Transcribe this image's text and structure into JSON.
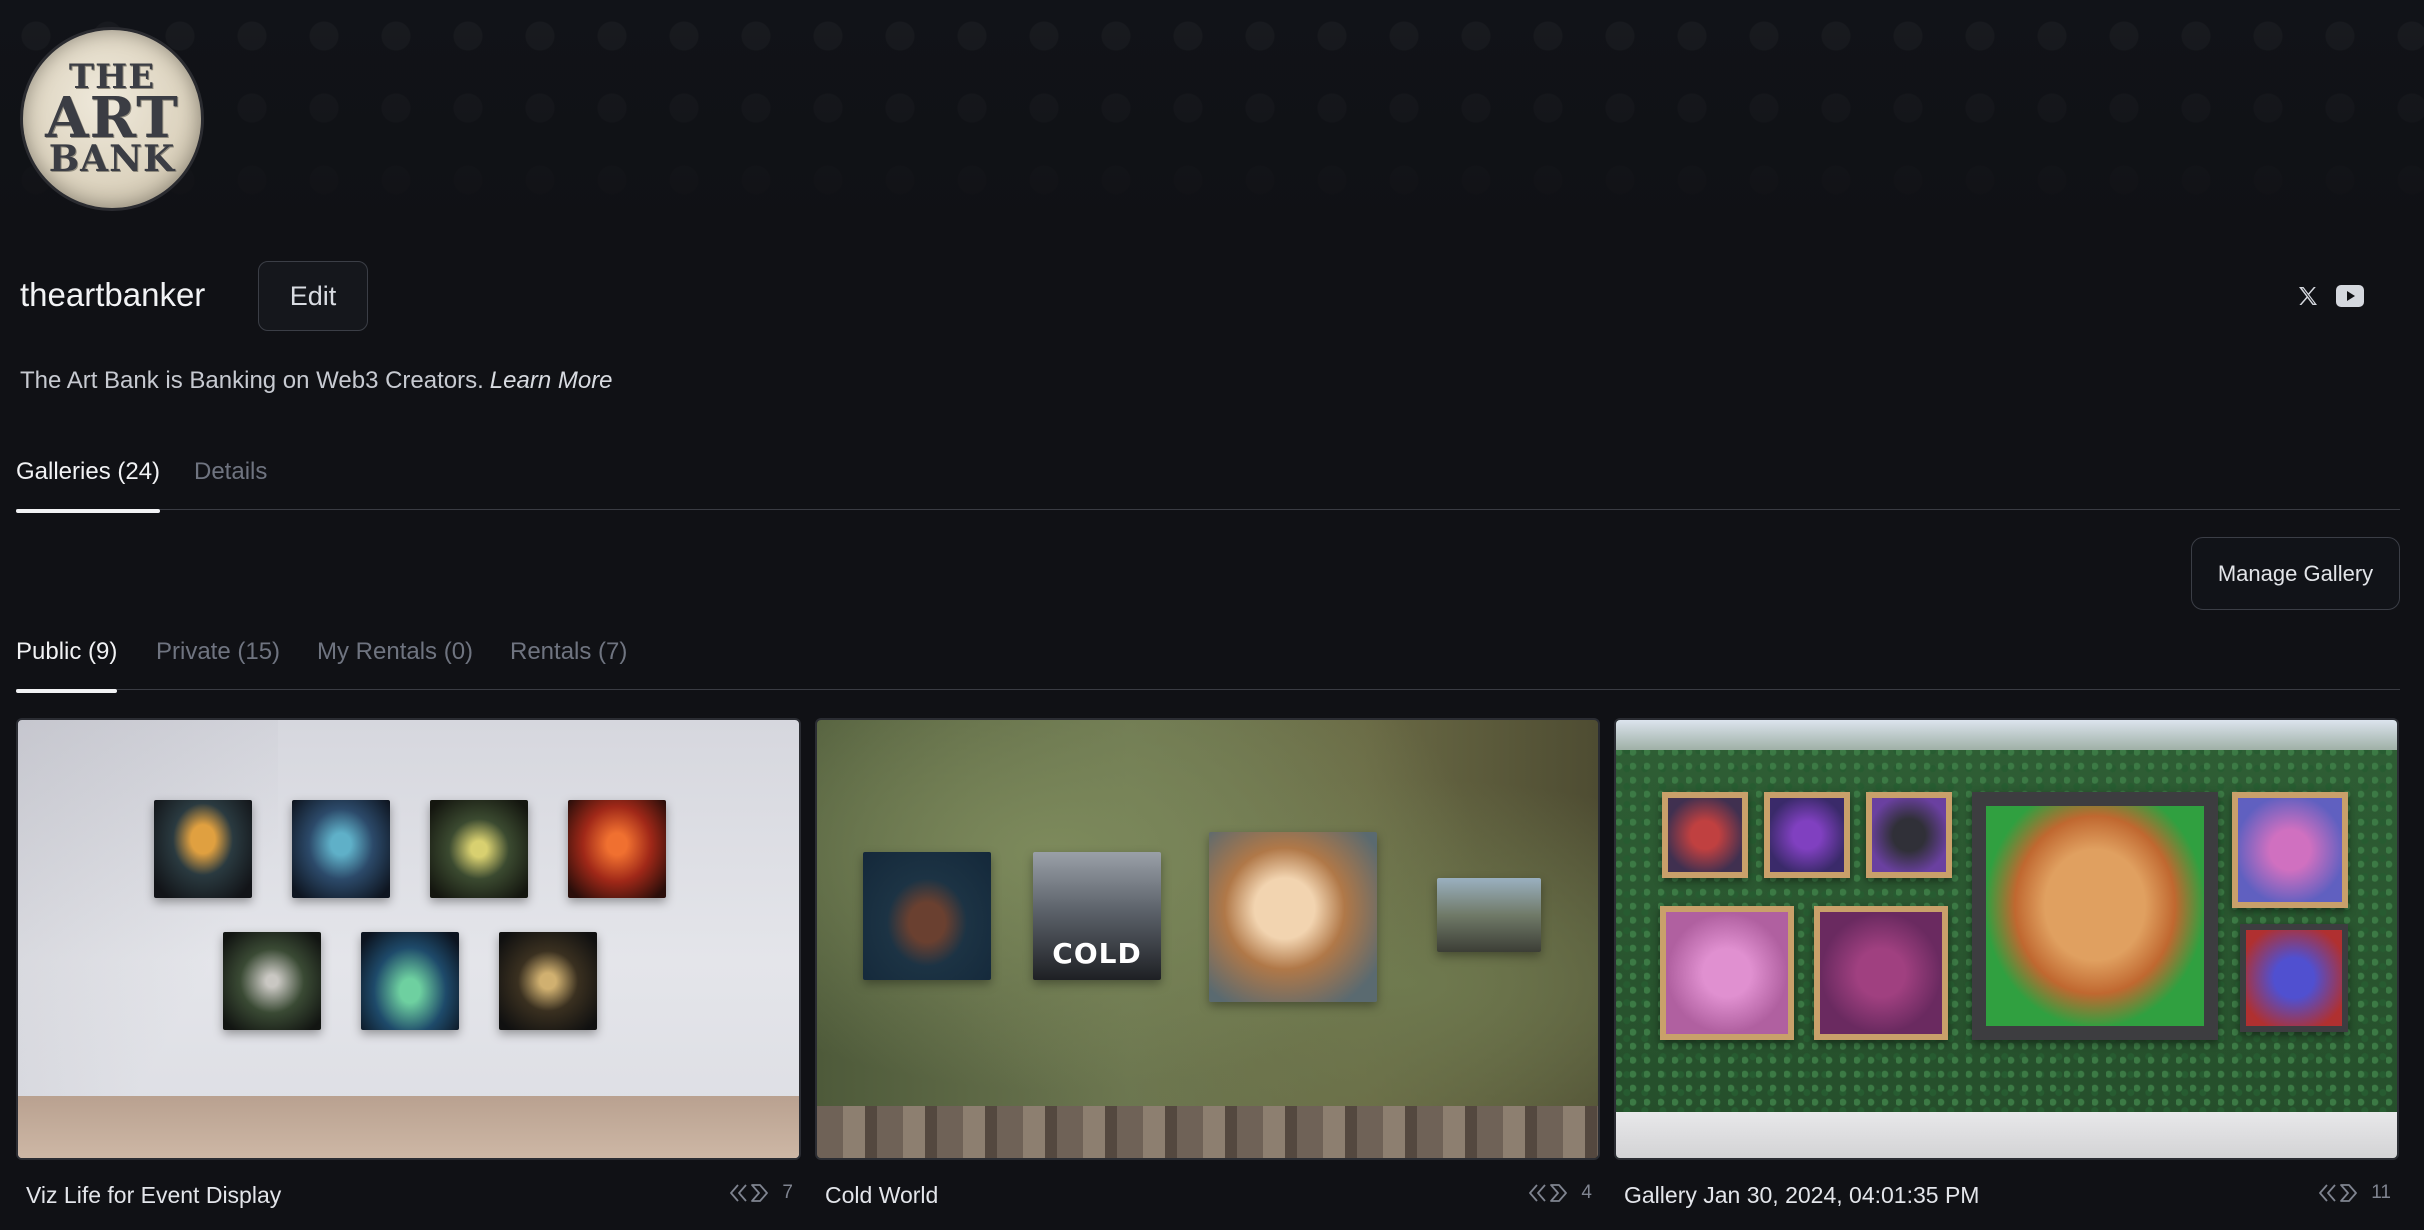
{
  "profile": {
    "avatar_text": [
      "THE",
      "ART",
      "BANK"
    ],
    "username": "theartbanker",
    "edit_label": "Edit",
    "bio": "The Art Bank is Banking on Web3 Creators.",
    "learn_more": "Learn More",
    "social_icons": [
      "x-icon",
      "youtube-icon"
    ]
  },
  "main_tabs": [
    {
      "label": "Galleries (24)",
      "active": true
    },
    {
      "label": "Details",
      "active": false
    }
  ],
  "manage_gallery_label": "Manage Gallery",
  "gallery_tabs": [
    {
      "label": "Public (9)",
      "active": true
    },
    {
      "label": "Private (15)",
      "active": false
    },
    {
      "label": "My Rentals (0)",
      "active": false
    },
    {
      "label": "Rentals (7)",
      "active": false
    }
  ],
  "galleries": [
    {
      "title": "Viz Life for Event Display",
      "count": "7",
      "icon": "views-chevron-icon"
    },
    {
      "title": "Cold World",
      "count": "4",
      "icon": "views-chevron-icon"
    },
    {
      "title": "Gallery Jan 30, 2024, 04:01:35 PM",
      "count": "11",
      "icon": "views-chevron-icon"
    }
  ],
  "colors": {
    "background": "#101115",
    "text": "#e6e8ec",
    "muted_tab": "#6f7480",
    "border": "#3a3c43"
  }
}
